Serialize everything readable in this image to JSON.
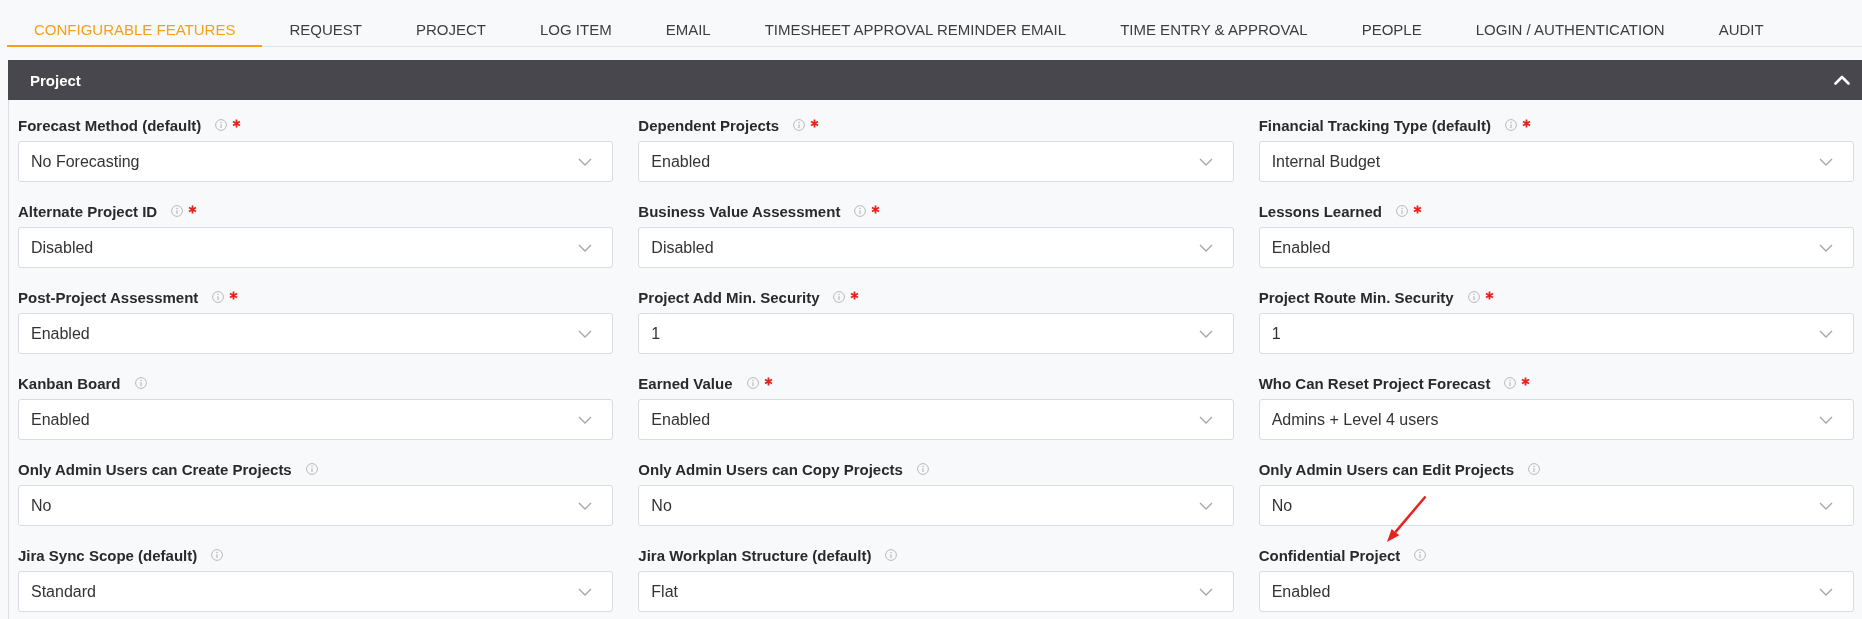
{
  "tabs": [
    {
      "label": "CONFIGURABLE FEATURES",
      "selected": true
    },
    {
      "label": "REQUEST",
      "selected": false
    },
    {
      "label": "PROJECT",
      "selected": false
    },
    {
      "label": "LOG ITEM",
      "selected": false
    },
    {
      "label": "EMAIL",
      "selected": false
    },
    {
      "label": "TIMESHEET APPROVAL REMINDER EMAIL",
      "selected": false
    },
    {
      "label": "TIME ENTRY & APPROVAL",
      "selected": false
    },
    {
      "label": "PEOPLE",
      "selected": false
    },
    {
      "label": "LOGIN / AUTHENTICATION",
      "selected": false
    },
    {
      "label": "AUDIT",
      "selected": false
    }
  ],
  "section": {
    "title": "Project",
    "expanded": true,
    "fields": [
      {
        "label": "Forecast Method (default)",
        "required": true,
        "value": "No Forecasting",
        "annotated": false
      },
      {
        "label": "Dependent Projects",
        "required": true,
        "value": "Enabled",
        "annotated": false
      },
      {
        "label": "Financial Tracking Type (default)",
        "required": true,
        "value": "Internal Budget",
        "annotated": false
      },
      {
        "label": "Alternate Project ID",
        "required": true,
        "value": "Disabled",
        "annotated": false
      },
      {
        "label": "Business Value Assessment",
        "required": true,
        "value": "Disabled",
        "annotated": false
      },
      {
        "label": "Lessons Learned",
        "required": true,
        "value": "Enabled",
        "annotated": false
      },
      {
        "label": "Post-Project Assessment",
        "required": true,
        "value": "Enabled",
        "annotated": false
      },
      {
        "label": "Project Add Min. Security",
        "required": true,
        "value": "1",
        "annotated": false
      },
      {
        "label": "Project Route Min. Security",
        "required": true,
        "value": "1",
        "annotated": false
      },
      {
        "label": "Kanban Board",
        "required": false,
        "value": "Enabled",
        "annotated": false
      },
      {
        "label": "Earned Value",
        "required": true,
        "value": "Enabled",
        "annotated": false
      },
      {
        "label": "Who Can Reset Project Forecast",
        "required": true,
        "value": "Admins + Level 4 users",
        "annotated": false
      },
      {
        "label": "Only Admin Users can Create Projects",
        "required": false,
        "value": "No",
        "annotated": false
      },
      {
        "label": "Only Admin Users can Copy Projects",
        "required": false,
        "value": "No",
        "annotated": false
      },
      {
        "label": "Only Admin Users can Edit Projects",
        "required": false,
        "value": "No",
        "annotated": false
      },
      {
        "label": "Jira Sync Scope (default)",
        "required": false,
        "value": "Standard",
        "annotated": false
      },
      {
        "label": "Jira Workplan Structure (default)",
        "required": false,
        "value": "Flat",
        "annotated": false
      },
      {
        "label": "Confidential Project",
        "required": false,
        "value": "Enabled",
        "annotated": true
      }
    ]
  }
}
